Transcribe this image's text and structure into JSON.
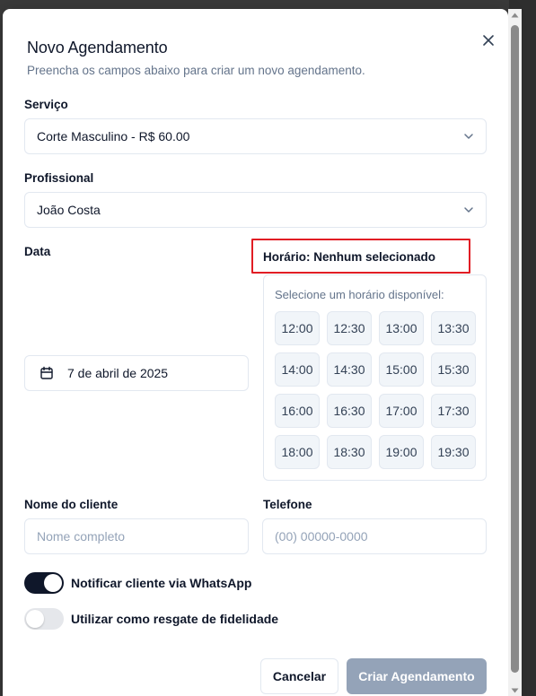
{
  "dialog": {
    "title": "Novo Agendamento",
    "subtitle": "Preencha os campos abaixo para criar um novo agendamento."
  },
  "service": {
    "label": "Serviço",
    "selected": "Corte Masculino - R$ 60.00"
  },
  "professional": {
    "label": "Profissional",
    "selected": "João Costa"
  },
  "date": {
    "label": "Data",
    "value": "7 de abril de 2025"
  },
  "time": {
    "label": "Horário: Nenhum selecionado",
    "hint": "Selecione um horário disponível:",
    "slots": [
      "12:00",
      "12:30",
      "13:00",
      "13:30",
      "14:00",
      "14:30",
      "15:00",
      "15:30",
      "16:00",
      "16:30",
      "17:00",
      "17:30",
      "18:00",
      "18:30",
      "19:00",
      "19:30"
    ]
  },
  "client": {
    "name_label": "Nome do cliente",
    "name_placeholder": "Nome completo",
    "phone_label": "Telefone",
    "phone_placeholder": "(00) 00000-0000"
  },
  "options": {
    "whatsapp_label": "Notificar cliente via WhatsApp",
    "whatsapp_on": true,
    "loyalty_label": "Utilizar como resgate de fidelidade",
    "loyalty_on": false
  },
  "actions": {
    "cancel_label": "Cancelar",
    "create_label": "Criar Agendamento"
  },
  "colors": {
    "primary": "#0f172a",
    "muted": "#64748b",
    "disabled_button": "#94a3b8",
    "highlight": "#e11d24"
  },
  "icons": {
    "close": "close-icon",
    "chevron": "chevron-down-icon",
    "calendar": "calendar-icon"
  }
}
